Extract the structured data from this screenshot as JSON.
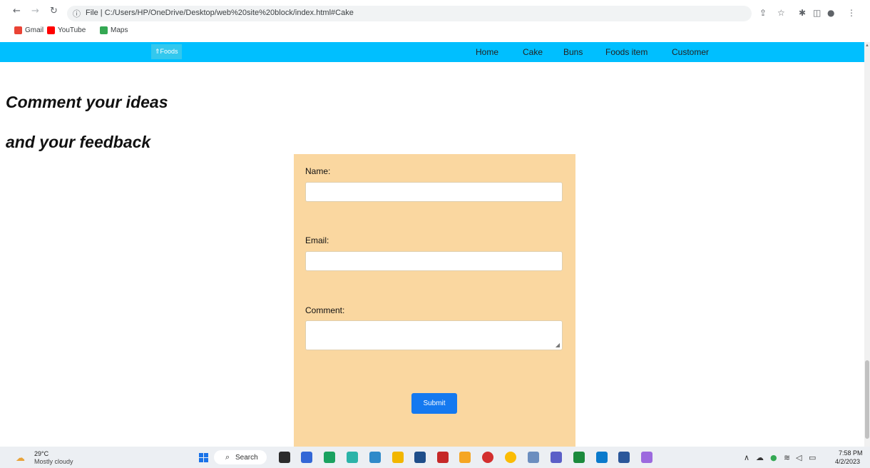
{
  "browser": {
    "url": "C:/Users/HP/OneDrive/Desktop/web%20site%20block/index.html#Cake",
    "url_prefix": "File",
    "bookmarks": [
      {
        "label": "Gmail",
        "color": "#ea4335"
      },
      {
        "label": "YouTube",
        "color": "#ff0000"
      },
      {
        "label": "Maps",
        "color": "#34a853"
      }
    ]
  },
  "site": {
    "brand": "Foods",
    "accent": "#00bfff",
    "nav": [
      "Home",
      "Cake",
      "Buns",
      "Foods item",
      "Customer"
    ]
  },
  "page": {
    "heading1": "Comment your ideas",
    "heading2": "and your feedback",
    "form": {
      "panel_color": "#fad7a0",
      "name_label": "Name:",
      "email_label": "Email:",
      "comment_label": "Comment:",
      "name_value": "",
      "email_value": "",
      "comment_value": "",
      "submit_label": "Submit",
      "submit_color": "#1479f0"
    }
  },
  "taskbar": {
    "temperature": "29°C",
    "condition": "Mostly cloudy",
    "search_label": "Search",
    "time": "7:58 PM",
    "date": "4/2/2023"
  }
}
